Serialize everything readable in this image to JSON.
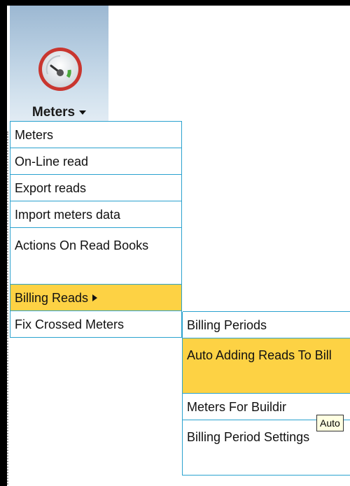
{
  "toolbar": {
    "meters_label": "Meters"
  },
  "menu": {
    "items": [
      "Meters",
      "On-Line read",
      "Export reads",
      "Import meters data",
      "Actions On Read Books",
      "Billing Reads",
      "Fix Crossed Meters"
    ]
  },
  "submenu": {
    "items": [
      "Billing Periods",
      "Auto Adding Reads To Bill",
      "Meters For Buildir",
      "Billing Period Settings"
    ]
  },
  "tooltip": {
    "text": "Auto"
  },
  "colors": {
    "highlight": "#fdd244",
    "menu_border": "#2aa2cf",
    "toolbar_gradient_top": "#9cb8d2"
  },
  "icons": {
    "gauge": "speedometer-icon"
  }
}
